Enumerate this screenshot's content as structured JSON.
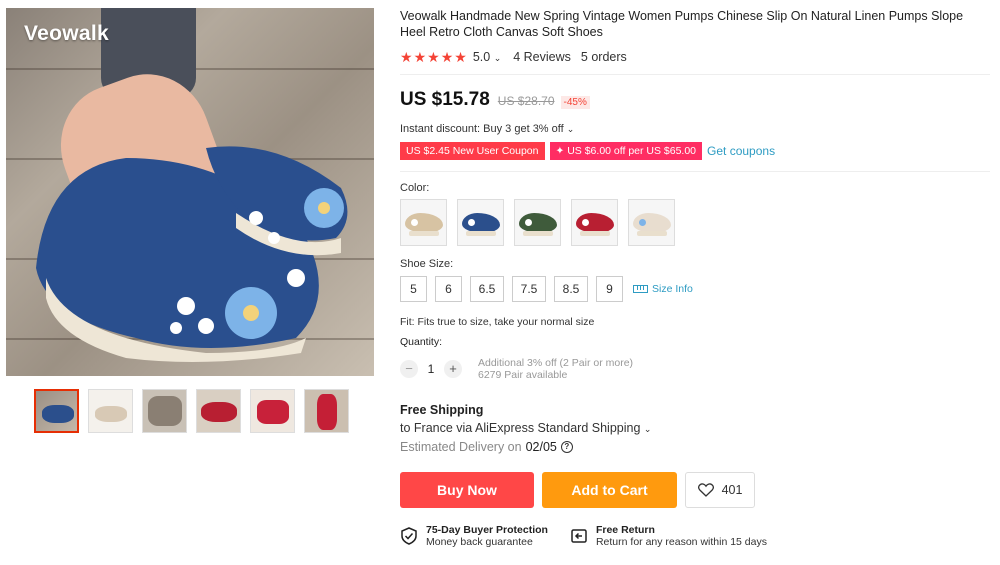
{
  "gallery": {
    "watermark": "Veowalk",
    "thumbnails": [
      "blue-floral",
      "beige-floral",
      "gray-wedge",
      "red-floral",
      "red-wedge",
      "red-side"
    ]
  },
  "product": {
    "title": "Veowalk Handmade New Spring Vintage Women Pumps Chinese Slip On Natural Linen Pumps Slope Heel Retro Cloth Canvas Soft Shoes",
    "rating": "5.0",
    "rating_caret": "⌄",
    "reviews": "4 Reviews",
    "orders": "5 orders"
  },
  "price": {
    "current": "US $15.78",
    "original": "US $28.70",
    "discount": "-45%"
  },
  "promo": {
    "instant": "Instant discount: Buy 3 get 3% off",
    "coupon1": "US $2.45 New User Coupon",
    "coupon2": "✦ US $6.00 off per US $65.00",
    "get_coupons": "Get coupons"
  },
  "color": {
    "label": "Color:",
    "options": [
      "#d7c3a3",
      "#2b4f8c",
      "#3f5b3b",
      "#b81f32",
      "#e8ddcf"
    ]
  },
  "size": {
    "label": "Shoe Size:",
    "options": [
      "5",
      "6",
      "6.5",
      "7.5",
      "8.5",
      "9"
    ],
    "info": "Size Info"
  },
  "fit": "Fit: Fits true to size, take your normal size",
  "quantity": {
    "label": "Quantity:",
    "minus": "−",
    "value": "1",
    "plus": "+",
    "note1": "Additional 3% off (2 Pair or more)",
    "note2": "6279 Pair available"
  },
  "shipping": {
    "title": "Free Shipping",
    "route": "to France via AliExpress Standard Shipping",
    "delivery_label": "Estimated Delivery on",
    "delivery_date": "02/05"
  },
  "actions": {
    "buy_now": "Buy Now",
    "add_to_cart": "Add to Cart",
    "wishlist_count": "401"
  },
  "guarantees": {
    "protection_title": "75-Day Buyer Protection",
    "protection_sub": "Money back guarantee",
    "return_title": "Free Return",
    "return_sub": "Return for any reason within 15 days"
  },
  "colors": {
    "accent_red": "#ff4747",
    "cart_orange": "#ff9a0e",
    "link_blue": "#2e9cc3",
    "star_red": "#f44336"
  }
}
